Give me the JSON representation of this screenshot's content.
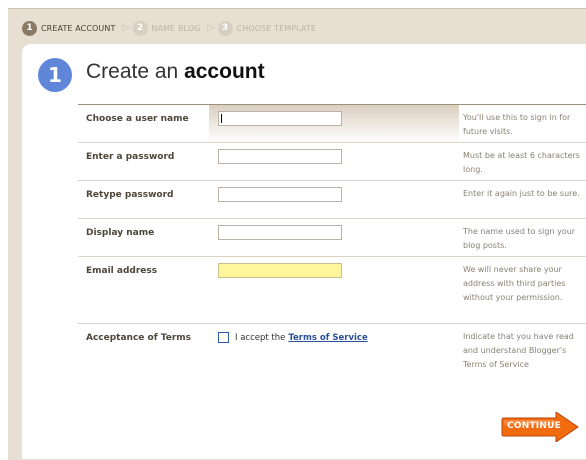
{
  "steps": [
    {
      "number": "1",
      "label": "CREATE ACCOUNT"
    },
    {
      "number": "2",
      "label": "NAME BLOG"
    },
    {
      "number": "3",
      "label": "CHOOSE TEMPLATE"
    }
  ],
  "form": {
    "step_number": "1",
    "title_prefix": "Create an",
    "title_bold": "account",
    "fields": {
      "username": {
        "label": "Choose a user name",
        "value": "",
        "help": "You'll use this to sign in for future visits."
      },
      "password": {
        "label": "Enter a password",
        "value": "",
        "help": "Must be at least 6 characters long."
      },
      "retype": {
        "label": "Retype password",
        "value": "",
        "help": "Enter it again just to be sure."
      },
      "display": {
        "label": "Display name",
        "value": "",
        "help": "The name used to sign your blog posts."
      },
      "email": {
        "label": "Email address",
        "value": "",
        "help": "We will never share your address with third parties without your permission."
      }
    },
    "terms": {
      "label": "Acceptance of Terms",
      "checkbox_text": "I accept the",
      "link_text": "Terms of Service",
      "checked": false,
      "help": "Indicate that you have read and understand Blogger's Terms of Service"
    }
  },
  "continue_label": "CONTINUE",
  "colors": {
    "accent_blue": "#5f86d9",
    "continue_orange": "#f26b0f",
    "email_highlight": "#fff59a"
  }
}
